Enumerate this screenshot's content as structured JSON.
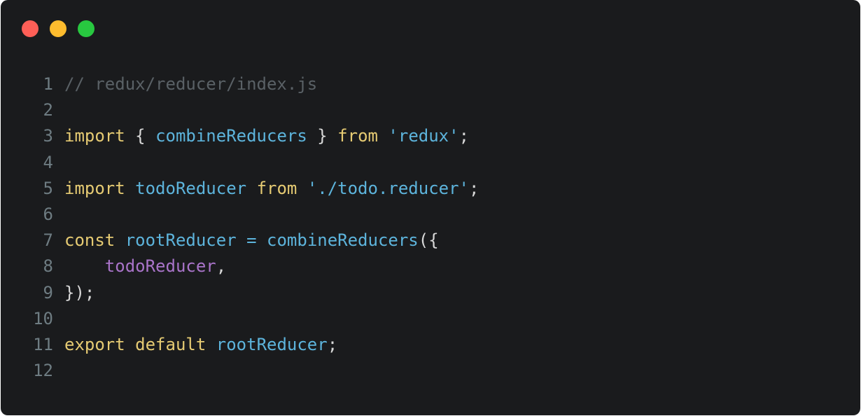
{
  "window": {
    "controls": [
      {
        "name": "close-dot",
        "color": "#ff5f57"
      },
      {
        "name": "minimize-dot",
        "color": "#febc2e"
      },
      {
        "name": "maximize-dot",
        "color": "#28c840"
      }
    ]
  },
  "colors": {
    "background": "#1a1b1d",
    "line_number": "#6e7c82",
    "comment": "#5a6166",
    "keyword": "#e6cb73",
    "identifier": "#5db4dc",
    "string": "#5db4dc",
    "property": "#a974c9",
    "punctuation": "#d8d8d8"
  },
  "code_lines": [
    {
      "number": "1",
      "tokens": [
        {
          "t": "comment",
          "text": "// redux/reducer/index.js"
        }
      ]
    },
    {
      "number": "2",
      "tokens": []
    },
    {
      "number": "3",
      "tokens": [
        {
          "t": "keyword",
          "text": "import"
        },
        {
          "t": "punctuation",
          "text": " { "
        },
        {
          "t": "identifier",
          "text": "combineReducers"
        },
        {
          "t": "punctuation",
          "text": " } "
        },
        {
          "t": "keyword",
          "text": "from"
        },
        {
          "t": "punctuation",
          "text": " "
        },
        {
          "t": "string",
          "text": "'redux'"
        },
        {
          "t": "punctuation",
          "text": ";"
        }
      ]
    },
    {
      "number": "4",
      "tokens": []
    },
    {
      "number": "5",
      "tokens": [
        {
          "t": "keyword",
          "text": "import"
        },
        {
          "t": "punctuation",
          "text": " "
        },
        {
          "t": "identifier",
          "text": "todoReducer"
        },
        {
          "t": "punctuation",
          "text": " "
        },
        {
          "t": "keyword",
          "text": "from"
        },
        {
          "t": "punctuation",
          "text": " "
        },
        {
          "t": "string",
          "text": "'./todo.reducer'"
        },
        {
          "t": "punctuation",
          "text": ";"
        }
      ]
    },
    {
      "number": "6",
      "tokens": []
    },
    {
      "number": "7",
      "tokens": [
        {
          "t": "keyword",
          "text": "const"
        },
        {
          "t": "punctuation",
          "text": " "
        },
        {
          "t": "identifier",
          "text": "rootReducer"
        },
        {
          "t": "punctuation",
          "text": " "
        },
        {
          "t": "identifier",
          "text": "="
        },
        {
          "t": "punctuation",
          "text": " "
        },
        {
          "t": "identifier",
          "text": "combineReducers"
        },
        {
          "t": "punctuation",
          "text": "({"
        }
      ]
    },
    {
      "number": "8",
      "tokens": [
        {
          "t": "punctuation",
          "text": "    "
        },
        {
          "t": "property",
          "text": "todoReducer"
        },
        {
          "t": "punctuation",
          "text": ","
        }
      ]
    },
    {
      "number": "9",
      "tokens": [
        {
          "t": "punctuation",
          "text": "});"
        }
      ]
    },
    {
      "number": "10",
      "tokens": []
    },
    {
      "number": "11",
      "tokens": [
        {
          "t": "keyword",
          "text": "export"
        },
        {
          "t": "punctuation",
          "text": " "
        },
        {
          "t": "keyword",
          "text": "default"
        },
        {
          "t": "punctuation",
          "text": " "
        },
        {
          "t": "identifier",
          "text": "rootReducer"
        },
        {
          "t": "punctuation",
          "text": ";"
        }
      ]
    },
    {
      "number": "12",
      "tokens": []
    }
  ]
}
